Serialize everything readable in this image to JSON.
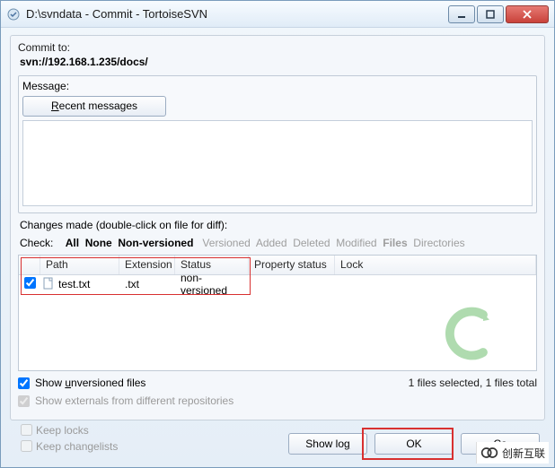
{
  "window": {
    "title": "D:\\svndata - Commit - TortoiseSVN"
  },
  "commit": {
    "label": "Commit to:",
    "url": "svn://192.168.1.235/docs/"
  },
  "message": {
    "label": "Message:",
    "recent_btn": "Recent messages",
    "text": ""
  },
  "changes": {
    "label": "Changes made (double-click on file for diff):",
    "check_label": "Check:",
    "filters": {
      "all": "All",
      "none": "None",
      "nonversioned": "Non-versioned",
      "versioned": "Versioned",
      "added": "Added",
      "deleted": "Deleted",
      "modified": "Modified",
      "files": "Files",
      "directories": "Directories"
    },
    "columns": {
      "path": "Path",
      "extension": "Extension",
      "status": "Status",
      "property": "Property status",
      "lock": "Lock"
    },
    "rows": [
      {
        "checked": true,
        "path": "test.txt",
        "extension": ".txt",
        "status": "non-versioned",
        "property": "",
        "lock": ""
      }
    ]
  },
  "footer": {
    "show_unversioned": "Show unversioned files",
    "show_externals": "Show externals from different repositories",
    "status": "1 files selected, 1 files total",
    "keep_locks": "Keep locks",
    "keep_changelists": "Keep changelists"
  },
  "buttons": {
    "showlog": "Show log",
    "ok": "OK",
    "cancel": "Cancel"
  },
  "brand": "创新互联"
}
